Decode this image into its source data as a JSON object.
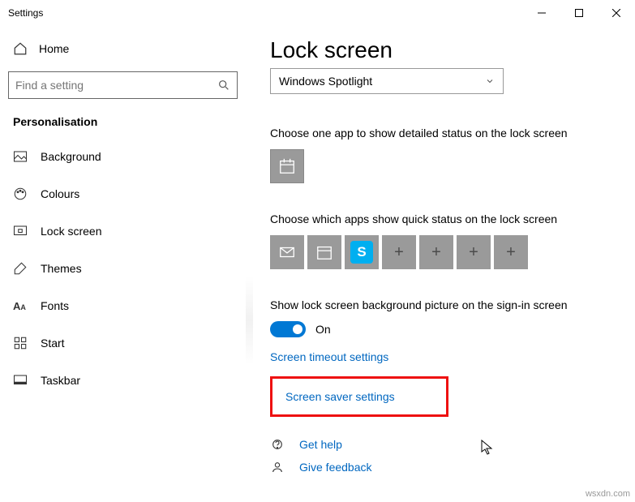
{
  "title": "Settings",
  "home": "Home",
  "search_placeholder": "Find a setting",
  "section": "Personalisation",
  "nav": {
    "background": "Background",
    "colours": "Colours",
    "lockscreen": "Lock screen",
    "themes": "Themes",
    "fonts": "Fonts",
    "start": "Start",
    "taskbar": "Taskbar"
  },
  "heading": "Lock screen",
  "dropdown": "Windows Spotlight",
  "detailed_label": "Choose one app to show detailed status on the lock screen",
  "quick_label": "Choose which apps show quick status on the lock screen",
  "bg_toggle_label": "Show lock screen background picture on the sign-in screen",
  "toggle_value": "On",
  "link_timeout": "Screen timeout settings",
  "link_saver": "Screen saver settings",
  "help": "Get help",
  "feedback": "Give feedback",
  "watermark": "wsxdn.com"
}
